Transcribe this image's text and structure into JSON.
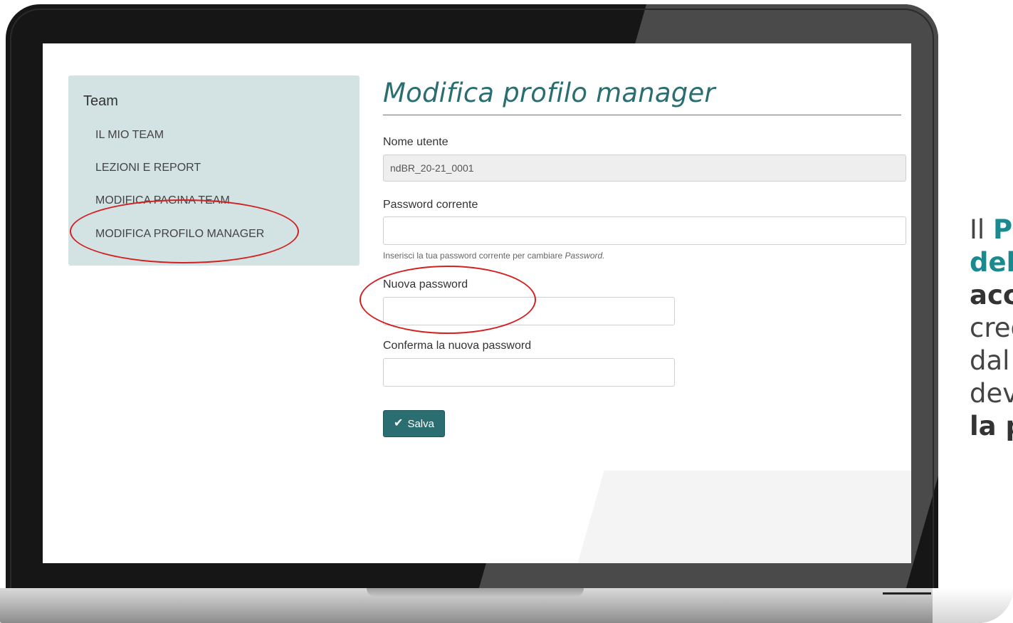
{
  "sidebar": {
    "title": "Team",
    "items": [
      {
        "label": "IL MIO TEAM"
      },
      {
        "label": "LEZIONI E REPORT"
      },
      {
        "label": "MODIFICA PAGINA TEAM"
      },
      {
        "label": "MODIFICA PROFILO MANAGER"
      }
    ]
  },
  "main": {
    "title": "Modifica profilo manager",
    "username_label": "Nome utente",
    "username_value": "ndBR_20-21_0001",
    "current_password_label": "Password corrente",
    "current_password_value": "",
    "current_password_help": "Inserisci la tua password corrente per cambiare",
    "current_password_help_em": "Password.",
    "new_password_label": "Nuova password",
    "new_password_value": "",
    "confirm_password_label": "Conferma la nuova password",
    "confirm_password_value": "",
    "save_label": "Salva"
  },
  "caption": {
    "line1_a": "Il ",
    "line1_b": "Pr",
    "line2": "del",
    "line3": "acc",
    "line4": "cred",
    "line5": "dal",
    "line6": "dev",
    "line7": "la p"
  },
  "colors": {
    "accent": "#2b6e72",
    "sidebar_bg": "#d3e2e3",
    "annotation": "#d32020",
    "caption_teal": "#1a8a8e"
  },
  "icons": {
    "save": "check-icon"
  }
}
